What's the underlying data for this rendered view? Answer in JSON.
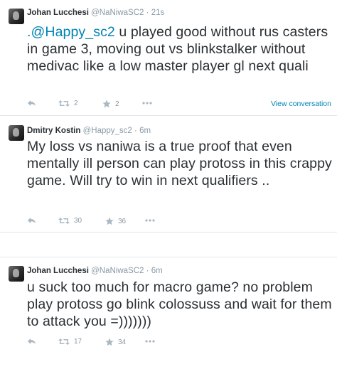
{
  "tweets": [
    {
      "name": "Johan Lucchesi",
      "handle": "@NaNiwaSC2",
      "separator": "·",
      "time": "21s",
      "mention": ".@Happy_sc2",
      "text": " u played good without rus casters in game 3, moving out vs blinkstalker without medivac like a low master player gl next quali",
      "retweets": "2",
      "favorites": "2",
      "view_conversation": "View conversation"
    },
    {
      "name": "Dmitry Kostin",
      "handle": "@Happy_sc2",
      "separator": "·",
      "time": "6m",
      "text": "My loss vs naniwa is a true proof that even mentally ill person can play protoss in this crappy game. Will try to win in next qualifiers ..",
      "retweets": "30",
      "favorites": "36"
    },
    {
      "name": "Johan Lucchesi",
      "handle": "@NaNiwaSC2",
      "separator": "·",
      "time": "6m",
      "text": "u suck too much for macro game? no problem play protoss go blink colossuss and wait for them to attack you =)))))))",
      "retweets": "17",
      "favorites": "34"
    }
  ],
  "icons": {
    "reply": "reply-arrow",
    "retweet": "retweet-arrows",
    "favorite": "star",
    "more": "three-dots"
  },
  "colors": {
    "link": "#0084b4",
    "muted": "#8899a6",
    "text": "#292f33",
    "border": "#e1e8ed"
  }
}
